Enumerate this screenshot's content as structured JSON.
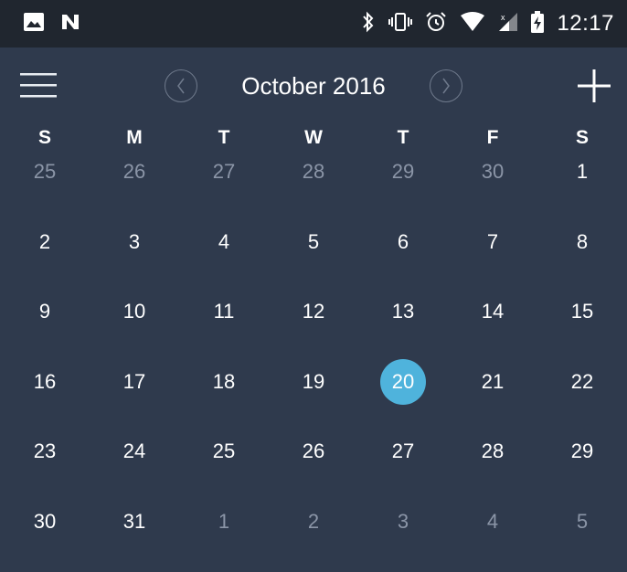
{
  "status_bar": {
    "time": "12:17",
    "left_icons": [
      "image-icon",
      "n-logo-icon"
    ],
    "right_icons": [
      "bluetooth-icon",
      "vibrate-icon",
      "alarm-icon",
      "wifi-icon",
      "signal-icon",
      "battery-charging-icon"
    ]
  },
  "toolbar": {
    "month_label": "October 2016",
    "menu_icon": "hamburger-menu-icon",
    "prev_icon": "chevron-left-icon",
    "next_icon": "chevron-right-icon",
    "add_icon": "plus-icon"
  },
  "weekdays": [
    "S",
    "M",
    "T",
    "W",
    "T",
    "F",
    "S"
  ],
  "days": [
    {
      "label": "25",
      "muted": true
    },
    {
      "label": "26",
      "muted": true
    },
    {
      "label": "27",
      "muted": true
    },
    {
      "label": "28",
      "muted": true
    },
    {
      "label": "29",
      "muted": true
    },
    {
      "label": "30",
      "muted": true
    },
    {
      "label": "1",
      "muted": false
    },
    {
      "label": "2",
      "muted": false
    },
    {
      "label": "3",
      "muted": false
    },
    {
      "label": "4",
      "muted": false
    },
    {
      "label": "5",
      "muted": false
    },
    {
      "label": "6",
      "muted": false
    },
    {
      "label": "7",
      "muted": false
    },
    {
      "label": "8",
      "muted": false
    },
    {
      "label": "9",
      "muted": false
    },
    {
      "label": "10",
      "muted": false
    },
    {
      "label": "11",
      "muted": false
    },
    {
      "label": "12",
      "muted": false
    },
    {
      "label": "13",
      "muted": false
    },
    {
      "label": "14",
      "muted": false
    },
    {
      "label": "15",
      "muted": false
    },
    {
      "label": "16",
      "muted": false
    },
    {
      "label": "17",
      "muted": false
    },
    {
      "label": "18",
      "muted": false
    },
    {
      "label": "19",
      "muted": false
    },
    {
      "label": "20",
      "muted": false,
      "today": true
    },
    {
      "label": "21",
      "muted": false
    },
    {
      "label": "22",
      "muted": false
    },
    {
      "label": "23",
      "muted": false
    },
    {
      "label": "24",
      "muted": false
    },
    {
      "label": "25",
      "muted": false
    },
    {
      "label": "26",
      "muted": false
    },
    {
      "label": "27",
      "muted": false
    },
    {
      "label": "28",
      "muted": false
    },
    {
      "label": "29",
      "muted": false
    },
    {
      "label": "30",
      "muted": false
    },
    {
      "label": "31",
      "muted": false
    },
    {
      "label": "1",
      "muted": true
    },
    {
      "label": "2",
      "muted": true
    },
    {
      "label": "3",
      "muted": true
    },
    {
      "label": "4",
      "muted": true
    },
    {
      "label": "5",
      "muted": true
    }
  ],
  "colors": {
    "background": "#2f3a4d",
    "status_bar": "#20262f",
    "today_highlight": "#4fb3dc",
    "muted_text": "#8b95a7"
  }
}
